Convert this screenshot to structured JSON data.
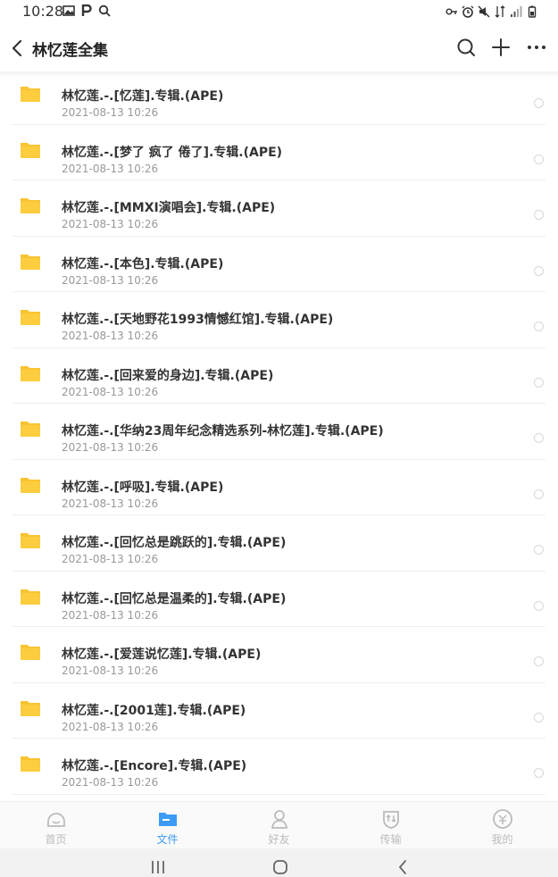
{
  "status_bar": {
    "time": "10:28",
    "left_icons": [
      "image-icon",
      "p-icon",
      "search-icon"
    ],
    "right_icons": [
      "key-icon",
      "alarm-icon",
      "mute-icon",
      "network-icon",
      "signal-icon",
      "battery-icon"
    ]
  },
  "header": {
    "title": "林忆莲全集",
    "back_icon": "chevron-left-icon",
    "actions": [
      "search-icon",
      "plus-icon",
      "more-icon"
    ]
  },
  "colors": {
    "folder": "#f9c433",
    "accent": "#3d9bf5",
    "inactive": "#bbbbbb"
  },
  "files": [
    {
      "name": "林忆莲.-.[忆莲].专辑.(APE)",
      "date": "2021-08-13  10:26"
    },
    {
      "name": "林忆莲.-.[梦了 疯了 倦了].专辑.(APE)",
      "date": "2021-08-13  10:26"
    },
    {
      "name": "林忆莲.-.[MMXI演唱会].专辑.(APE)",
      "date": "2021-08-13  10:26"
    },
    {
      "name": "林忆莲.-.[本色].专辑.(APE)",
      "date": "2021-08-13  10:26"
    },
    {
      "name": "林忆莲.-.[天地野花1993情憾红馆].专辑.(APE)",
      "date": "2021-08-13  10:26"
    },
    {
      "name": "林忆莲.-.[回来爱的身边].专辑.(APE)",
      "date": "2021-08-13  10:26"
    },
    {
      "name": "林忆莲.-.[华纳23周年纪念精选系列-林忆莲].专辑.(APE)",
      "date": "2021-08-13  10:26"
    },
    {
      "name": "林忆莲.-.[呼吸].专辑.(APE)",
      "date": "2021-08-13  10:26"
    },
    {
      "name": "林忆莲.-.[回忆总是跳跃的].专辑.(APE)",
      "date": "2021-08-13  10:26"
    },
    {
      "name": "林忆莲.-.[回忆总是温柔的].专辑.(APE)",
      "date": "2021-08-13  10:26"
    },
    {
      "name": "林忆莲.-.[爱莲说忆莲].专辑.(APE)",
      "date": "2021-08-13  10:26"
    },
    {
      "name": "林忆莲.-.[2001莲].专辑.(APE)",
      "date": "2021-08-13  10:26"
    },
    {
      "name": "林忆莲.-.[Encore].专辑.(APE)",
      "date": "2021-08-13  10:26"
    }
  ],
  "bottom_nav": [
    {
      "label": "首页",
      "icon": "home-icon",
      "active": false
    },
    {
      "label": "文件",
      "icon": "folder-icon",
      "active": true
    },
    {
      "label": "好友",
      "icon": "friends-icon",
      "active": false
    },
    {
      "label": "传输",
      "icon": "transfer-icon",
      "active": false
    },
    {
      "label": "我的",
      "icon": "profile-icon",
      "active": false
    }
  ],
  "system_nav": [
    "recents-icon",
    "home-button-icon",
    "back-icon"
  ]
}
